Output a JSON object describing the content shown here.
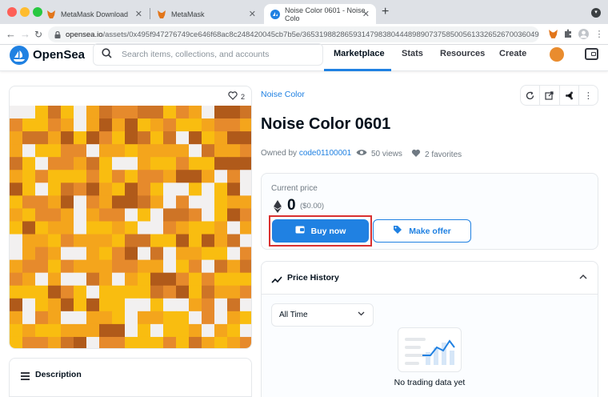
{
  "browser": {
    "tabs": [
      {
        "title": "MetaMask Download",
        "active": false
      },
      {
        "title": "MetaMask",
        "active": false
      },
      {
        "title": "Noise Color 0601 - Noise Colo",
        "active": true
      }
    ],
    "new_tab": "+",
    "url_host": "opensea.io",
    "url_path": "/assets/0x495f947276749ce646f68ac8c248420045cb7b5e/36531988286593147983804448989073758500561332652670036049..."
  },
  "site": {
    "name": "OpenSea",
    "search_placeholder": "Search items, collections, and accounts",
    "nav": [
      "Marketplace",
      "Stats",
      "Resources",
      "Create"
    ]
  },
  "asset": {
    "favorites_count": "2",
    "collection": "Noise Color",
    "title": "Noise Color 0601",
    "owned_by_label": "Owned by",
    "owner": "code01100001",
    "views": "50 views",
    "favorites": "2 favorites",
    "pixel_colors": [
      "#f2f0f0",
      "#f4a51c",
      "#f9bd10",
      "#e68a2c",
      "#b05a1a",
      "#ce7426"
    ]
  },
  "price": {
    "label": "Current price",
    "value": "0",
    "usd": "($0.00)",
    "buy_label": "Buy now",
    "offer_label": "Make offer"
  },
  "history": {
    "title": "Price History",
    "period": "All Time",
    "empty_text": "No trading data yet"
  },
  "description": {
    "title": "Description"
  },
  "colors": {
    "accent": "#2081e2",
    "highlight": "#d93030"
  }
}
